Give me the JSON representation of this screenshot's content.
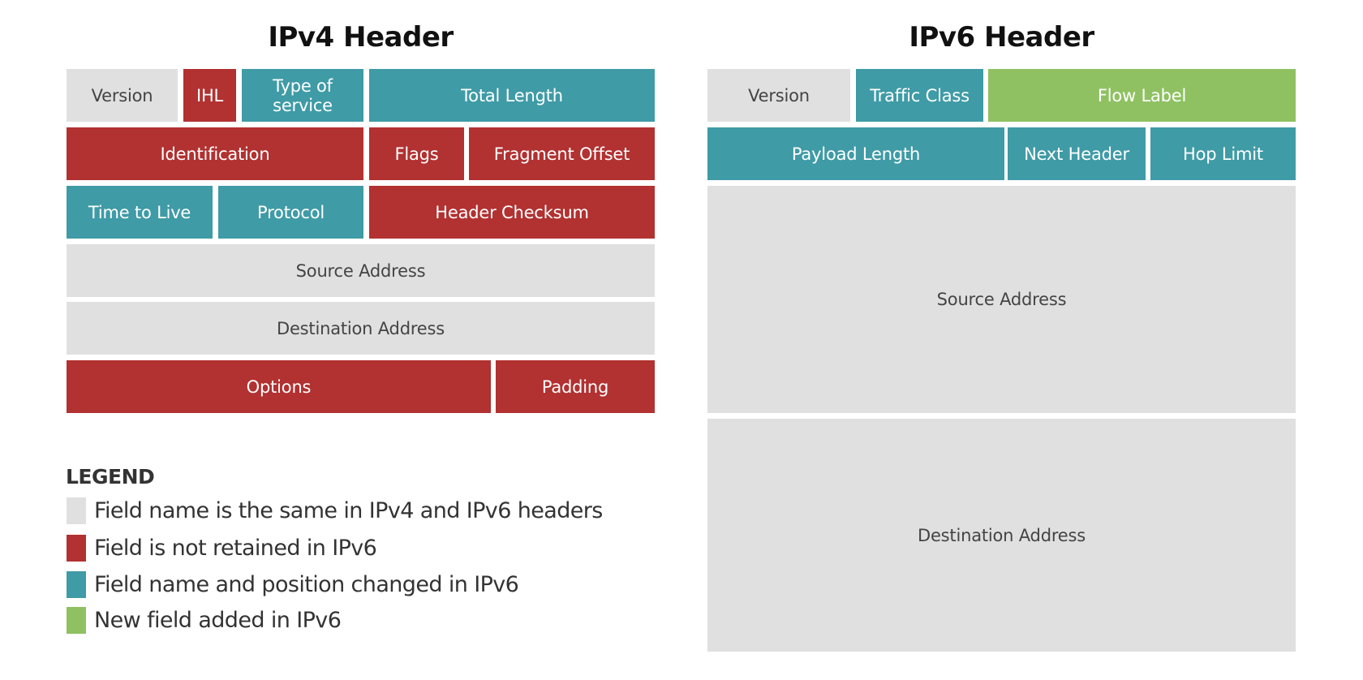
{
  "colors": {
    "same": "#dfe0df",
    "removed": "#b23131",
    "changed": "#3f9ba6",
    "added": "#8fc162"
  },
  "ipv4": {
    "title": "IPv4 Header",
    "fields": {
      "version": "Version",
      "ihl": "IHL",
      "type_of_service": "Type of service",
      "total_length": "Total Length",
      "identification": "Identification",
      "flags": "Flags",
      "fragment_offset": "Fragment Offset",
      "time_to_live": "Time to Live",
      "protocol": "Protocol",
      "header_checksum": "Header Checksum",
      "source_address": "Source Address",
      "destination_address": "Destination Address",
      "options": "Options",
      "padding": "Padding"
    }
  },
  "ipv6": {
    "title": "IPv6 Header",
    "fields": {
      "version": "Version",
      "traffic_class": "Traffic Class",
      "flow_label": "Flow Label",
      "payload_length": "Payload Length",
      "next_header": "Next Header",
      "hop_limit": "Hop Limit",
      "source_address": "Source Address",
      "destination_address": "Destination Address"
    }
  },
  "legend": {
    "title": "LEGEND",
    "items": [
      {
        "category": "same",
        "label": "Field name is the same in IPv4 and IPv6 headers"
      },
      {
        "category": "removed",
        "label": "Field is not retained in IPv6"
      },
      {
        "category": "changed",
        "label": "Field name and position changed in IPv6"
      },
      {
        "category": "added",
        "label": "New field added in IPv6"
      }
    ]
  }
}
